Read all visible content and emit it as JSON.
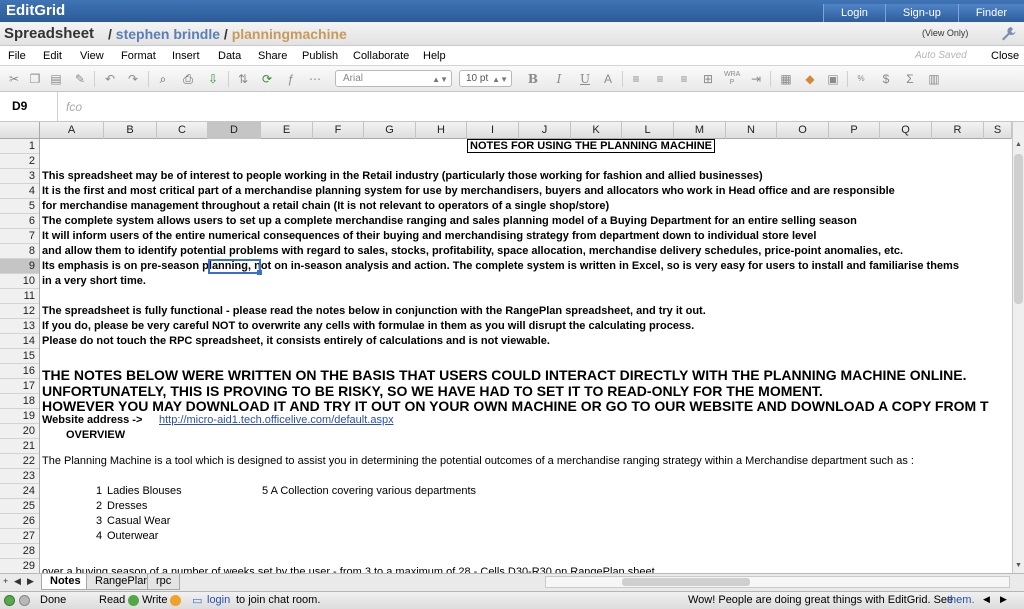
{
  "app": {
    "logo": "EditGrid",
    "nav": [
      "Login",
      "Sign-up",
      "Finder"
    ]
  },
  "title": {
    "app_name": "Spreadsheet",
    "sep1": "/",
    "user": "stephen brindle",
    "sep2": "/",
    "doc": "planningmachine",
    "view_only": "(View Only)"
  },
  "menu": {
    "items": [
      "File",
      "Edit",
      "View",
      "Format",
      "Insert",
      "Data",
      "Share",
      "Publish",
      "Collaborate",
      "Help"
    ],
    "auto_saved": "Auto Saved",
    "close": "Close"
  },
  "toolbar": {
    "font": "Arial",
    "font_size": "10 pt",
    "bold": "B",
    "italic": "I",
    "underline": "U",
    "currency": "$",
    "sum": "Σ"
  },
  "formula": {
    "cell_ref": "D9",
    "fx": "fco"
  },
  "grid": {
    "columns": [
      "A",
      "B",
      "C",
      "D",
      "E",
      "F",
      "G",
      "H",
      "I",
      "J",
      "K",
      "L",
      "M",
      "N",
      "O",
      "P",
      "Q",
      "R",
      "S"
    ],
    "selected_column": "D",
    "rows": [
      "1",
      "2",
      "3",
      "4",
      "5",
      "6",
      "7",
      "8",
      "9",
      "10",
      "11",
      "12",
      "13",
      "14",
      "15",
      "16",
      "17",
      "18",
      "19",
      "20",
      "21",
      "22",
      "23",
      "24",
      "25",
      "26",
      "27",
      "28",
      "29"
    ],
    "selected_row": "9"
  },
  "content": {
    "r1": "NOTES FOR USING THE PLANNING MACHINE",
    "r3": "This spreadsheet may be of interest to people working in the Retail industry (particularly those working for fashion and allied businesses)",
    "r4": "It is the first and most critical part of a merchandise planning system for use by merchandisers, buyers and allocators who work in Head office and are responsible",
    "r5": "for merchandise management throughout a retail chain (It is not relevant to operators of a single shop/store)",
    "r6": "The complete system allows users to set up a complete merchandise ranging and sales planning model of a Buying Department for an entire selling season",
    "r7": "It will inform users of the entire numerical consequences of their buying and merchandising strategy from department down to individual store level",
    "r8": "and allow them to identify potential problems with regard to sales, stocks, profitability, space allocation, merchandise delivery schedules, price-point anomalies, etc.",
    "r9": "Its emphasis is on pre-season planning, not on in-season analysis and action. The complete system is written in Excel, so is very easy for users to install and familiarise thems",
    "r10": "in a very short time.",
    "r12": "The spreadsheet is fully functional - please read the notes below in conjunction with the RangePlan spreadsheet, and try it out.",
    "r13": "If you do, please be very careful NOT to overwrite any cells with formulae in them as you will disrupt the calculating process.",
    "r14": "Please do not touch the RPC spreadsheet, it consists entirely of calculations and is not viewable.",
    "r16": "THE NOTES BELOW WERE WRITTEN ON THE BASIS THAT USERS COULD INTERACT DIRECTLY WITH THE PLANNING MACHINE ONLINE.",
    "r17": "UNFORTUNATELY, THIS IS PROVING TO BE RISKY, SO WE HAVE HAD TO SET IT TO READ-ONLY FOR THE MOMENT.",
    "r18": "HOWEVER YOU MAY DOWNLOAD IT AND TRY IT OUT ON YOUR OWN MACHINE OR GO TO OUR WEBSITE AND DOWNLOAD A COPY FROM T",
    "r19_label": "Website address ->",
    "r19_link": "http://micro-aid1.tech.officelive.com/default.aspx",
    "r20": "OVERVIEW",
    "r22": "The Planning Machine is a tool which is designed to assist you in determining the potential outcomes of a merchandise ranging strategy within a Merchandise department such as :",
    "list": [
      {
        "num": "1",
        "label": "Ladies Blouses"
      },
      {
        "num": "2",
        "label": "Dresses"
      },
      {
        "num": "3",
        "label": "Casual Wear"
      },
      {
        "num": "4",
        "label": "Outerwear"
      }
    ],
    "r24_extra": "5 A Collection covering various departments",
    "r30": "over a buying season of a number of weeks set by the user - from 3 to a maximum of 28 - Cells D30-R30 on RangePlan sheet"
  },
  "sheets": [
    "Notes",
    "RangePlan",
    "rpc"
  ],
  "status": {
    "done": "Done",
    "read": "Read",
    "write": "Write",
    "login_link": "login",
    "chat": "to join chat room.",
    "promo": "Wow! People are doing great things with EditGrid. See",
    "promo_link": "them."
  }
}
